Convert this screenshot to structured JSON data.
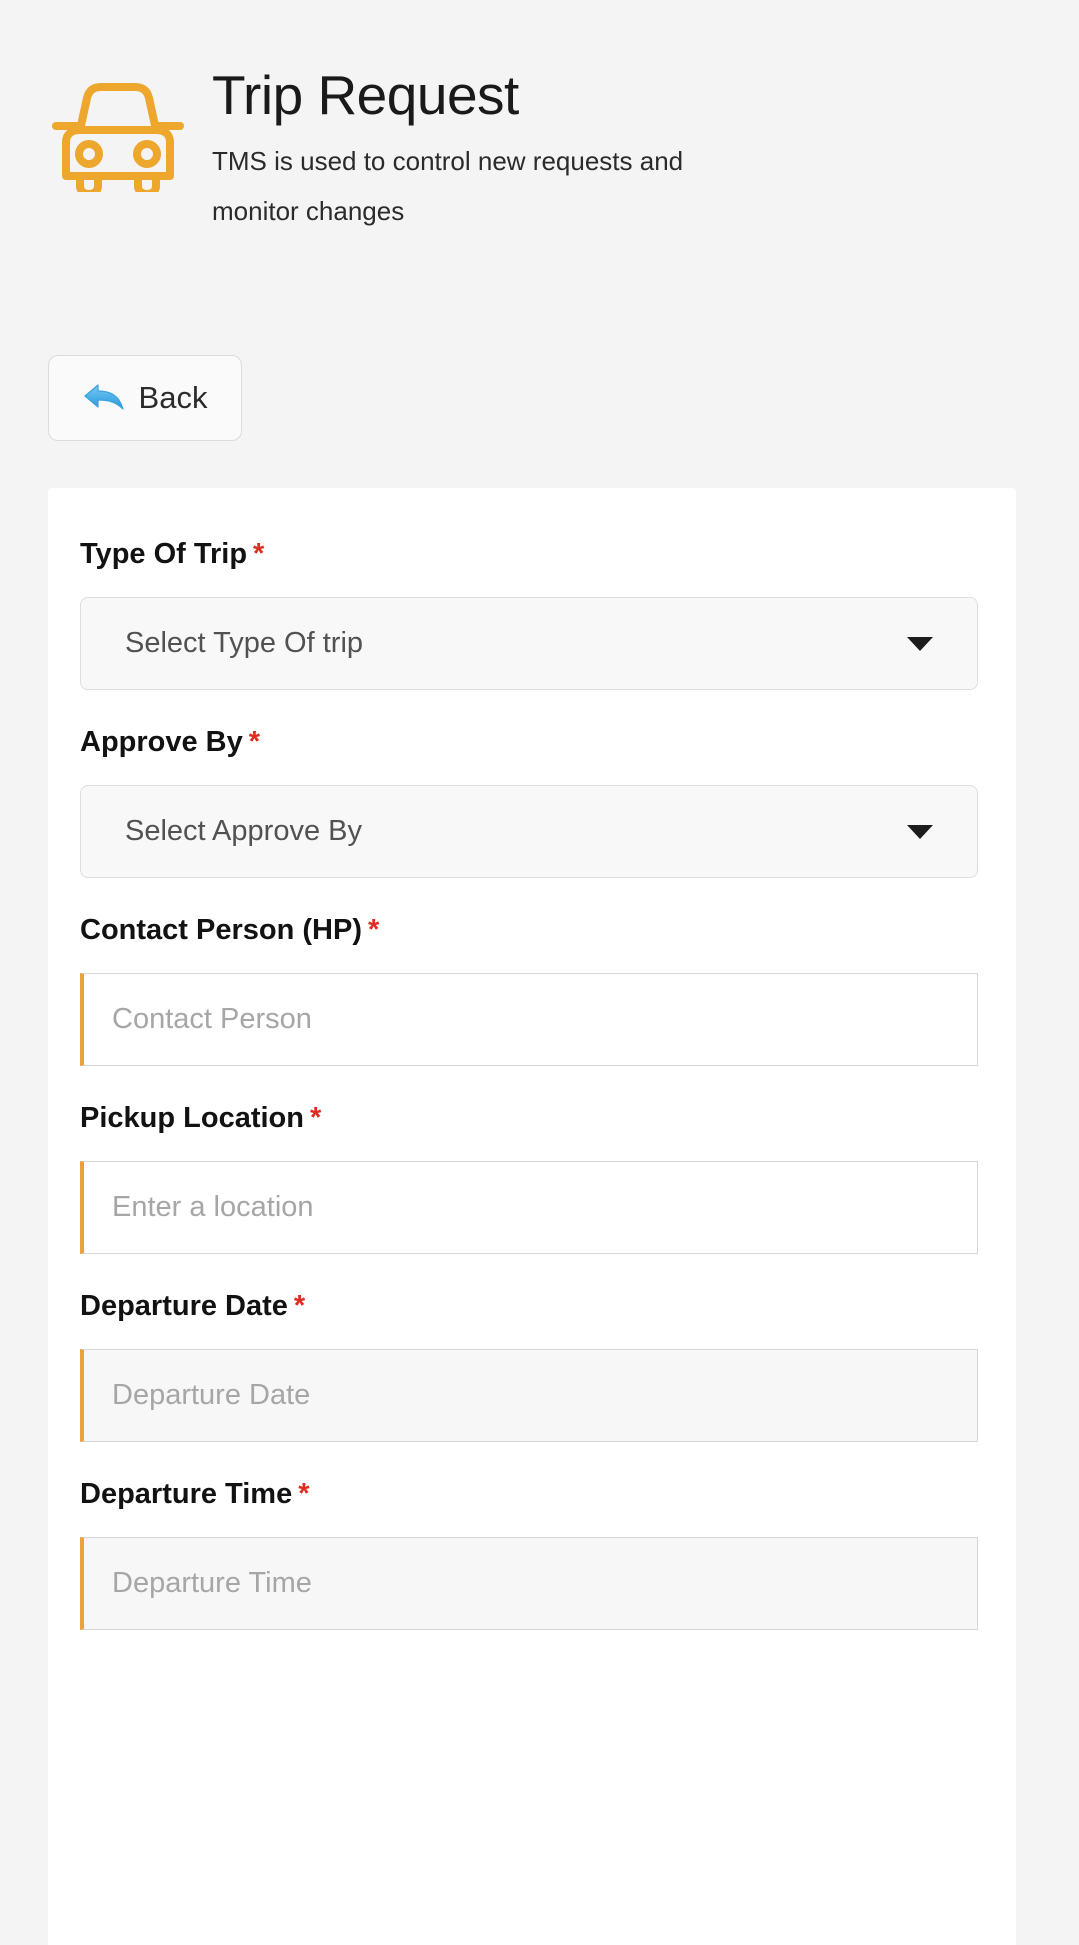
{
  "header": {
    "icon": "car-front-icon",
    "icon_color": "#eca72c",
    "title": "Trip Request",
    "subtitle": "TMS is used to control new requests and monitor changes"
  },
  "toolbar": {
    "back_label": "Back",
    "back_icon": "left-arrow-icon"
  },
  "theme": {
    "page_background": "#f4f4f4",
    "card_background": "#ffffff",
    "accent": "#eca72c",
    "required_marker_color": "#e02b20",
    "text_primary": "#121212",
    "placeholder": "#a6a6a6"
  },
  "form": {
    "required_marker": "*",
    "fields": [
      {
        "label": "Type Of Trip",
        "required": true,
        "type": "select",
        "placeholder": "Select Type Of trip",
        "value": "",
        "caret": "chevron-down-icon"
      },
      {
        "label": "Approve By",
        "required": true,
        "type": "select",
        "placeholder": "Select Approve By",
        "value": "",
        "caret": "chevron-down-icon"
      },
      {
        "label": "Contact Person (HP)",
        "required": true,
        "type": "text",
        "placeholder": "Contact Person",
        "value": ""
      },
      {
        "label": "Pickup Location",
        "required": true,
        "type": "text",
        "placeholder": "Enter a location",
        "value": ""
      },
      {
        "label": "Departure Date",
        "required": true,
        "type": "date",
        "placeholder": "Departure Date",
        "value": ""
      },
      {
        "label": "Departure Time",
        "required": true,
        "type": "time",
        "placeholder": "Departure Time",
        "value": ""
      }
    ]
  }
}
